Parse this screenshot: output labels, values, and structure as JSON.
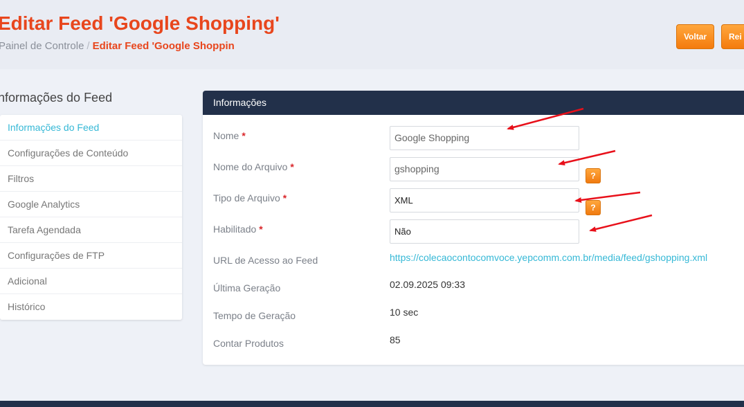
{
  "header": {
    "title": "Editar Feed 'Google Shopping'",
    "breadcrumb": {
      "home": "Painel de Controle",
      "separator": "/",
      "current": "Editar Feed 'Google Shoppin"
    },
    "buttons": {
      "back": "Voltar",
      "reset": "Rei"
    }
  },
  "sidebar": {
    "title": "nformações do Feed",
    "items": [
      {
        "label": "Informações do Feed"
      },
      {
        "label": "Configurações de Conteúdo"
      },
      {
        "label": "Filtros"
      },
      {
        "label": "Google Analytics"
      },
      {
        "label": "Tarefa Agendada"
      },
      {
        "label": "Configurações de FTP"
      },
      {
        "label": "Adicional"
      },
      {
        "label": "Histórico"
      }
    ]
  },
  "panel": {
    "title": "Informações",
    "required_mark": "*",
    "help_label": "?",
    "fields": {
      "name": {
        "label": "Nome",
        "value": "Google Shopping"
      },
      "filename": {
        "label": "Nome do Arquivo",
        "value": "gshopping"
      },
      "filetype": {
        "label": "Tipo de Arquivo",
        "value": "XML"
      },
      "enabled": {
        "label": "Habilitado",
        "value": "Não"
      },
      "url": {
        "label": "URL de Acesso ao Feed",
        "value": "https://colecaocontocomvoce.yepcomm.com.br/media/feed/gshopping.xml"
      },
      "last_generation": {
        "label": "Última Geração",
        "value": "02.09.2025 09:33"
      },
      "generation_time": {
        "label": "Tempo de Geração",
        "value": "10 sec"
      },
      "product_count": {
        "label": "Contar Produtos",
        "value": "85"
      }
    }
  },
  "colors": {
    "accent_orange": "#e8461d",
    "button_orange": "#f47b0d",
    "panel_header": "#22304a",
    "link": "#35b8d6",
    "annotation_arrow": "#e8101a"
  }
}
